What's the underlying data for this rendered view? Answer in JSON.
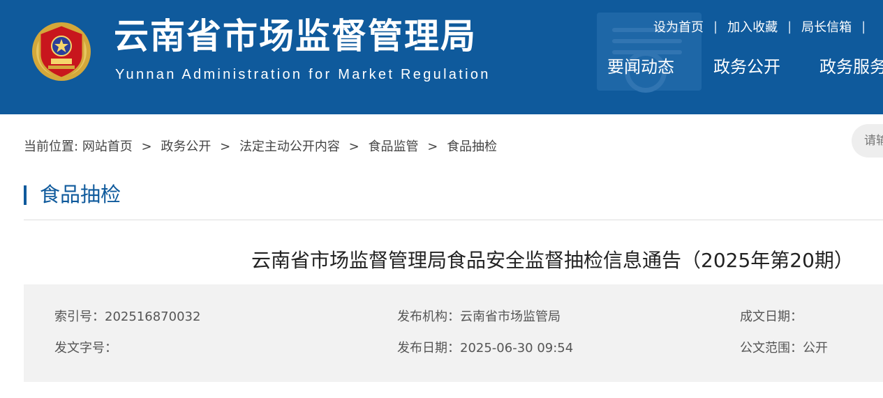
{
  "header": {
    "title": "云南省市场监督管理局",
    "subtitle": "Yunnan Administration for Market Regulation",
    "top_links": [
      "设为首页",
      "加入收藏",
      "局长信箱"
    ],
    "top_links_separator": "|",
    "nav": [
      "要闻动态",
      "政务公开",
      "政务服务"
    ]
  },
  "breadcrumb": {
    "prefix": "当前位置:",
    "separator": ">",
    "items": [
      "网站首页",
      "政务公开",
      "法定主动公开内容",
      "食品监管",
      "食品抽检"
    ]
  },
  "search": {
    "placeholder": "请输入关键词"
  },
  "section": {
    "title": "食品抽检"
  },
  "article": {
    "title": "云南省市场监督管理局食品安全监督抽检信息通告（2025年第20期）",
    "meta": {
      "index_no": "索引号：202516870032",
      "publisher": "发布机构：云南省市场监管局",
      "written_date": "成文日期：",
      "doc_no": "发文字号：",
      "publish_date": "发布日期：2025-06-30 09:54",
      "scope": "公文范围：公开"
    }
  },
  "colors": {
    "brand_blue": "#0f5a9c",
    "meta_background": "#f2f2f2",
    "emblem_red": "#c8161d",
    "emblem_gold": "#d4a83a"
  }
}
